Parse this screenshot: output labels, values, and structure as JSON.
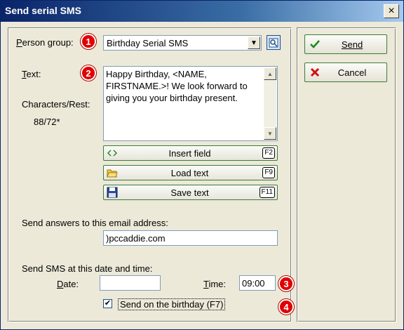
{
  "window": {
    "title": "Send serial SMS",
    "close_label": "×"
  },
  "form": {
    "person_group_label": "Person group:",
    "person_group_value": "Birthday Serial SMS",
    "text_label": "Text:",
    "message": "Happy Birthday, <NAME, FIRSTNAME.>! We look forward to giving you your birthday present.",
    "chars_label": "Characters/Rest:",
    "chars_value": "88/72*",
    "insert_field": {
      "label": "Insert field",
      "key": "F2"
    },
    "load_text": {
      "label": "Load text",
      "key": "F9"
    },
    "save_text": {
      "label": "Save text",
      "key": "F11"
    },
    "email_label": "Send answers to this email address:",
    "email_value": ")pccaddie.com",
    "datetime_label": "Send SMS at this date and time:",
    "date_label": "Date:",
    "date_value": "",
    "time_label": "Time:",
    "time_value": "09:00",
    "birthday_checkbox_label": "Send on the birthday (F7)",
    "birthday_checked": true
  },
  "actions": {
    "send_label": "Send",
    "cancel_label": "Cancel"
  },
  "badges": [
    "1",
    "2",
    "3",
    "4"
  ],
  "icons": {
    "dropdown_arrow": "▼",
    "search": "search-icon",
    "insert": "insert-field-icon",
    "load": "folder-open-icon",
    "save": "floppy-disk-icon",
    "send": "checkmark-icon",
    "cancel": "red-x-icon",
    "checkmark": "✔"
  },
  "colors": {
    "badge": "#e00000",
    "title_bar": "#0a246a",
    "button_border": "#3b7a3b"
  }
}
